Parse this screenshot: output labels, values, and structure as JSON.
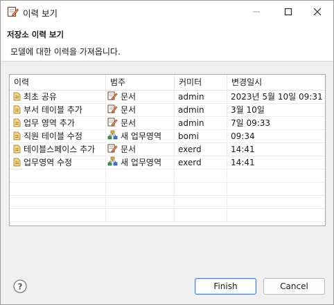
{
  "window": {
    "title": "이력 보기"
  },
  "header": {
    "title": "저장소 이력 보기",
    "message": "모델에 대한 이력을 가져옵니다."
  },
  "table": {
    "columns": [
      "이력",
      "범주",
      "커미터",
      "변경일시"
    ],
    "rows": [
      {
        "history": "최초 공유",
        "category": "문서",
        "category_icon": "document-edit-icon",
        "committer": "admin",
        "date": "2023년 5월 10일 09:31"
      },
      {
        "history": "부서 테이블 추가",
        "category": "문서",
        "category_icon": "document-edit-icon",
        "committer": "admin",
        "date": "3월 10일"
      },
      {
        "history": "업무 영역 추가",
        "category": "문서",
        "category_icon": "document-edit-icon",
        "committer": "admin",
        "date": "7일 09:33"
      },
      {
        "history": "직원 테이블 수정",
        "category": "새 업무영역",
        "category_icon": "subject-area-icon",
        "committer": "bomi",
        "date": "09:34"
      },
      {
        "history": "테이블스페이스 추가",
        "category": "문서",
        "category_icon": "document-edit-icon",
        "committer": "exerd",
        "date": "14:41"
      },
      {
        "history": "업무영역 수정",
        "category": "새 업무영역",
        "category_icon": "subject-area-icon",
        "committer": "exerd",
        "date": "14:41"
      }
    ]
  },
  "buttons": {
    "finish": "Finish",
    "cancel": "Cancel"
  },
  "colors": {
    "accent": "#3c7fd6",
    "doc_icon": "#d9a441",
    "edit_pen": "#c0392b"
  }
}
